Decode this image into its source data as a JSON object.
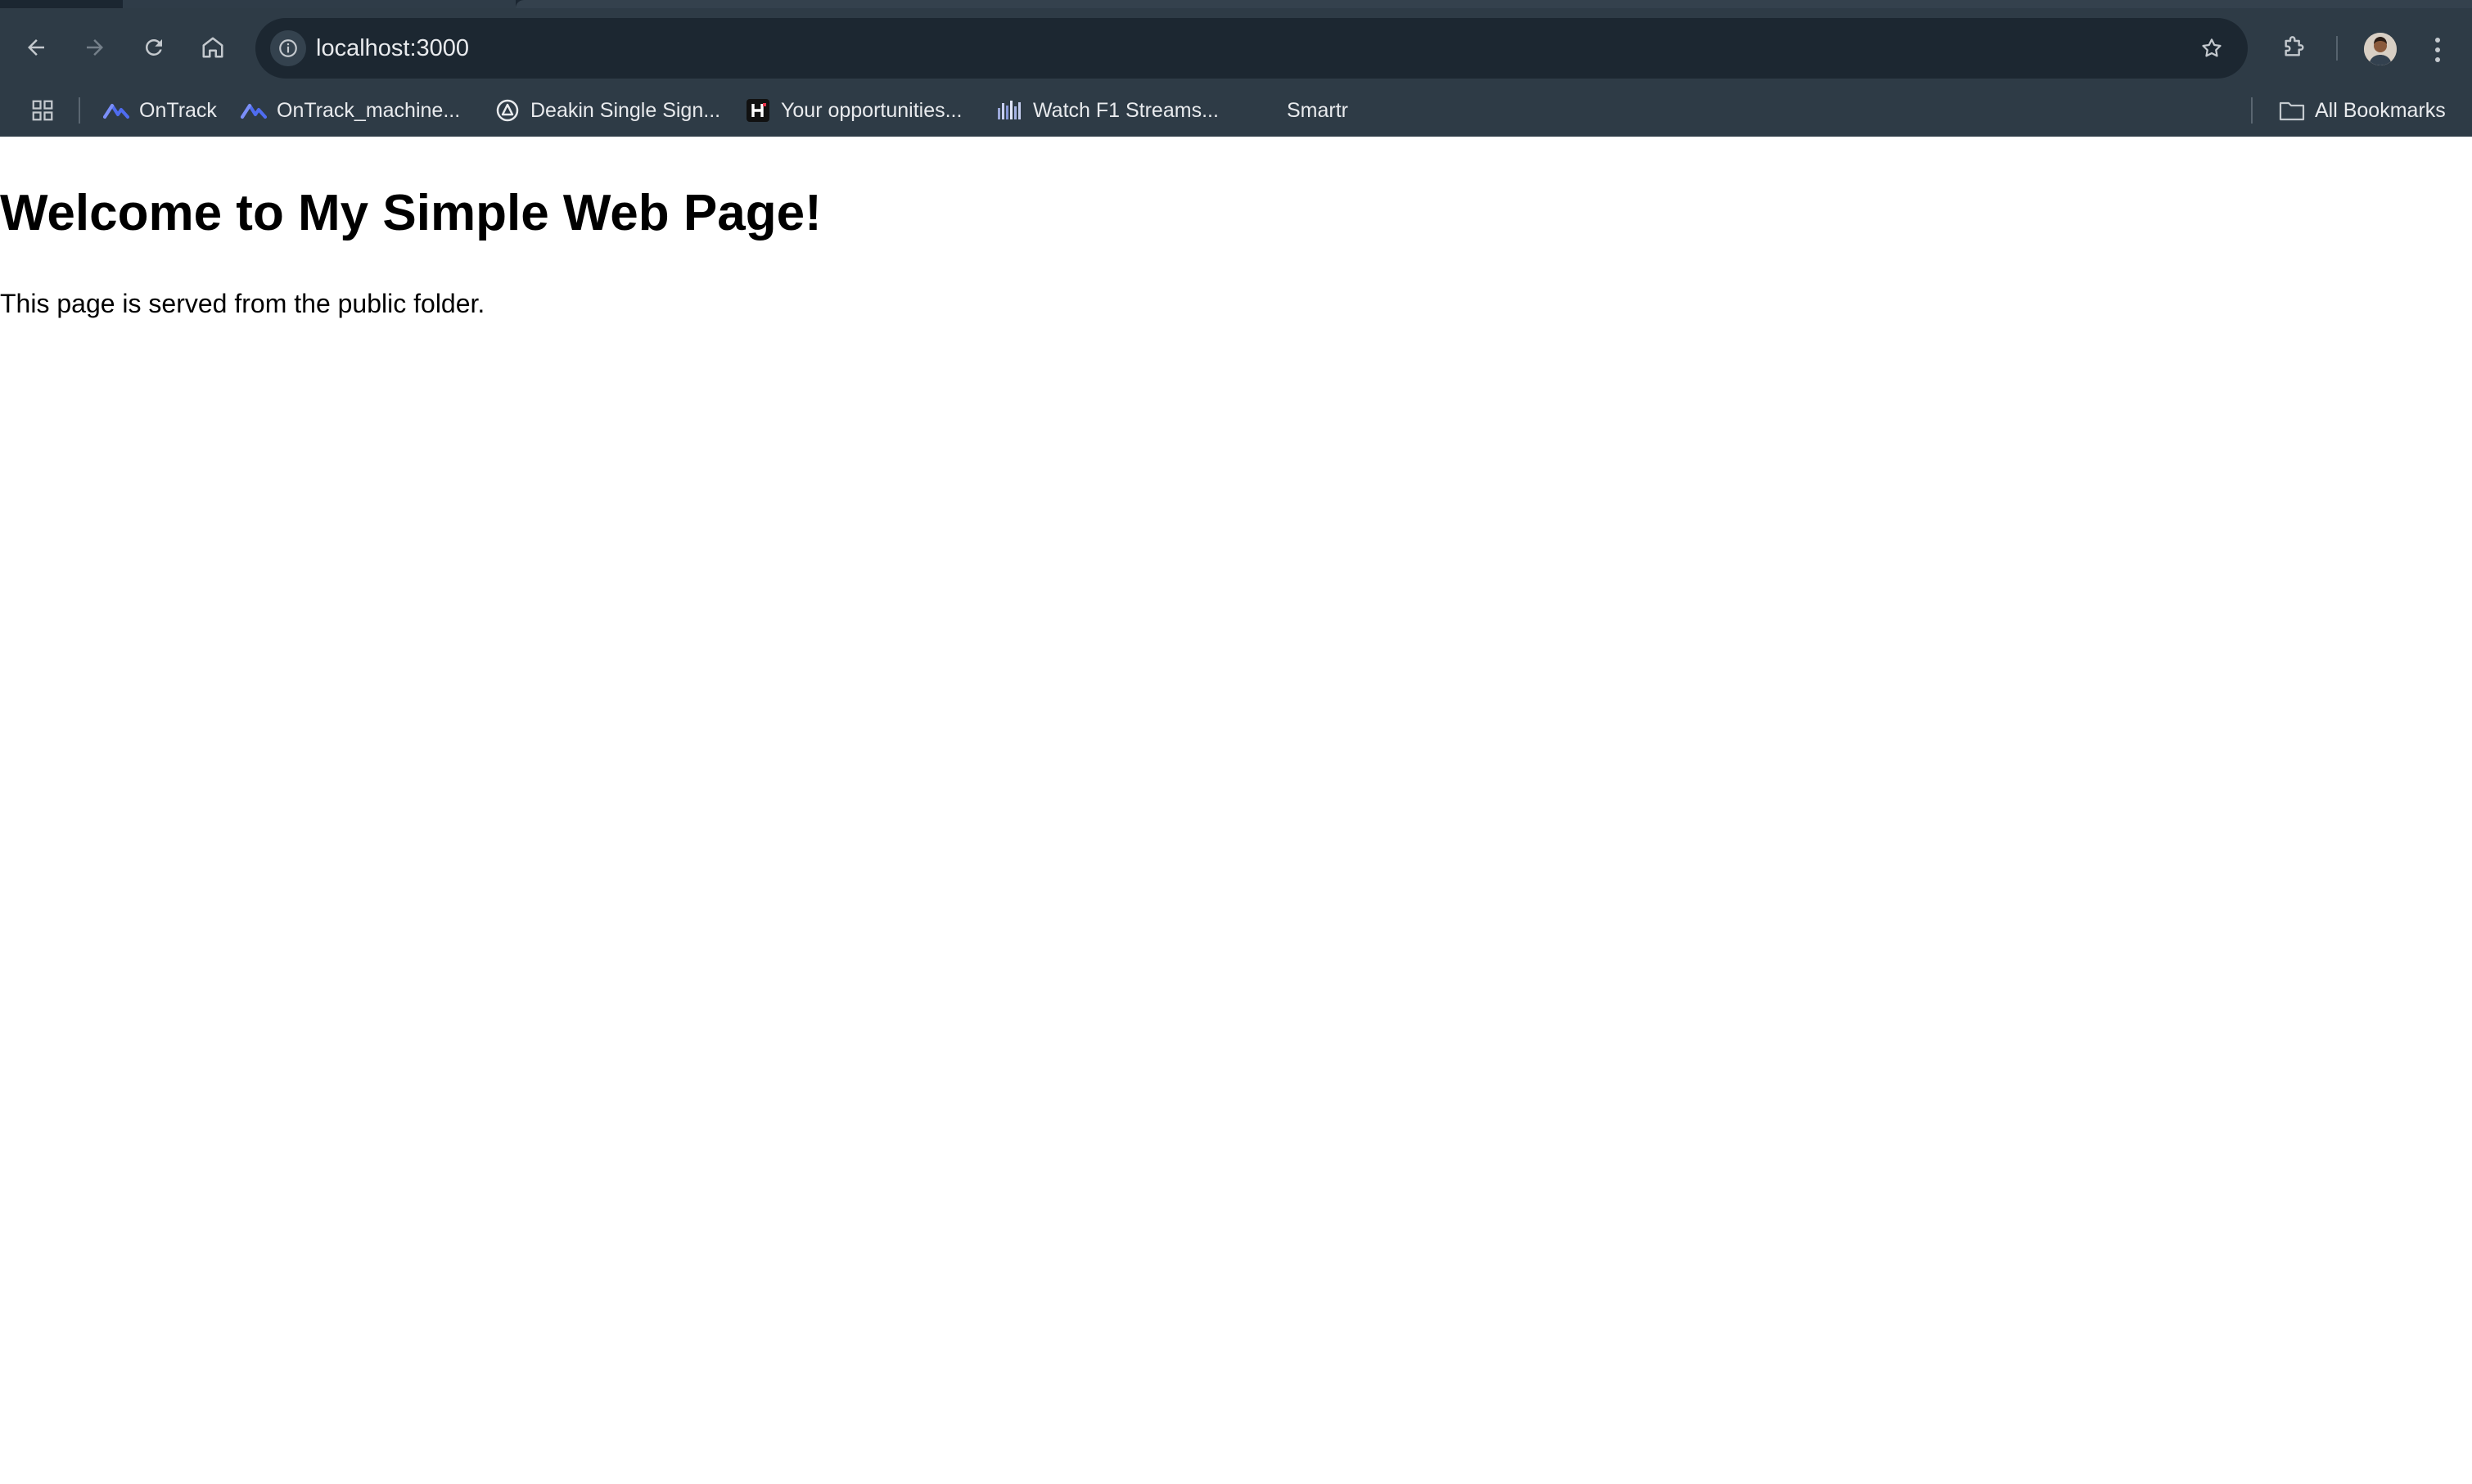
{
  "browser": {
    "address_bar": {
      "url": "localhost:3000"
    },
    "bookmarks": {
      "items": [
        {
          "label": "OnTrack",
          "icon": "ontrack-icon"
        },
        {
          "label": "OnTrack_machine...",
          "icon": "ontrack-icon"
        },
        {
          "label": "Deakin Single Sign...",
          "icon": "deakin-icon"
        },
        {
          "label": "Your opportunities...",
          "icon": "h-logo-icon"
        },
        {
          "label": "Watch F1 Streams...",
          "icon": "f1-streams-icon"
        },
        {
          "label": "Smartr",
          "icon": ""
        }
      ],
      "all_bookmarks_label": "All Bookmarks"
    },
    "colors": {
      "toolbar": "#2e3b46",
      "omnibox": "#1c2731",
      "text_light": "#e8eaed",
      "ontrack_accent": "#4f6cf0"
    }
  },
  "page": {
    "heading": "Welcome to My Simple Web Page!",
    "paragraph": "This page is served from the public folder."
  }
}
